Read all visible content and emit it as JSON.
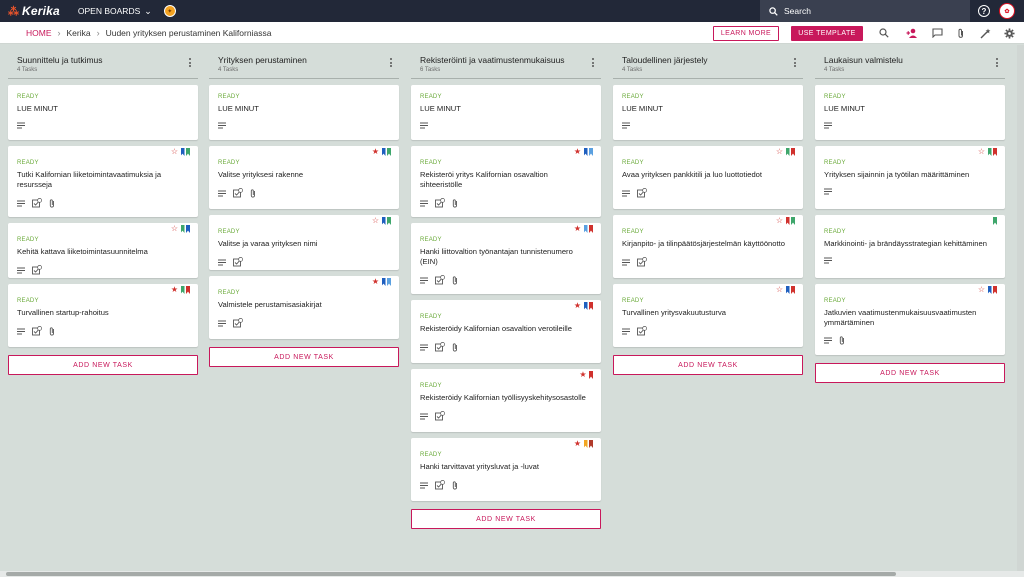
{
  "app": {
    "logo_text": "Kerika",
    "open_boards": "OPEN BOARDS",
    "search_placeholder": "Search"
  },
  "breadcrumb": {
    "home": "HOME",
    "org": "Kerika",
    "board": "Uuden yrityksen perustaminen Kaliforniassa"
  },
  "actions": {
    "learn_more": "LEARN MORE",
    "use_template": "USE TEMPLATE"
  },
  "colors": {
    "accent": "#c8185b",
    "ready": "#6aaa3a",
    "flag_red": "#d0312d",
    "flag_blue": "#1f5fbf",
    "flag_green": "#3ea66b",
    "flag_lightblue": "#5aa0e0",
    "flag_orange": "#f2a622",
    "flag_darkred": "#b13a2a"
  },
  "add_task_label": "ADD NEW TASK",
  "columns": [
    {
      "title": "Suunnittelu ja tutkimus",
      "count": "4 Tasks",
      "cards": [
        {
          "status": "READY",
          "title": "LUE MINUT",
          "star": "",
          "flags": [],
          "icons": [
            "desc"
          ]
        },
        {
          "status": "READY",
          "title": "Tutki Kalifornian liiketoimintavaatimuksia ja resursseja",
          "star": "outline",
          "flags": [
            "#1f5fbf",
            "#3ea66b"
          ],
          "icons": [
            "desc",
            "check",
            "clip"
          ]
        },
        {
          "status": "READY",
          "title": "Kehitä kattava liiketoimintasuunnitelma",
          "star": "outline",
          "flags": [
            "#3ea66b",
            "#1f5fbf"
          ],
          "icons": [
            "desc",
            "check"
          ]
        },
        {
          "status": "READY",
          "title": "Turvallinen startup-rahoitus",
          "star": "filled",
          "flags": [
            "#3ea66b",
            "#d0312d"
          ],
          "icons": [
            "desc",
            "check",
            "clip"
          ]
        }
      ]
    },
    {
      "title": "Yrityksen perustaminen",
      "count": "4 Tasks",
      "cards": [
        {
          "status": "READY",
          "title": "LUE MINUT",
          "star": "",
          "flags": [],
          "icons": [
            "desc"
          ]
        },
        {
          "status": "READY",
          "title": "Valitse yrityksesi rakenne",
          "star": "filled",
          "flags": [
            "#1f5fbf",
            "#3ea66b"
          ],
          "icons": [
            "desc",
            "check",
            "clip"
          ]
        },
        {
          "status": "READY",
          "title": "Valitse ja varaa yrityksen nimi",
          "star": "outline",
          "flags": [
            "#1f5fbf",
            "#3ea66b"
          ],
          "icons": [
            "desc",
            "check"
          ]
        },
        {
          "status": "READY",
          "title": "Valmistele perustamisasiakirjat",
          "star": "filled",
          "flags": [
            "#1f5fbf",
            "#5aa0e0"
          ],
          "icons": [
            "desc",
            "check"
          ]
        }
      ]
    },
    {
      "title": "Rekisteröinti ja vaatimustenmukaisuus",
      "count": "6 Tasks",
      "cards": [
        {
          "status": "READY",
          "title": "LUE MINUT",
          "star": "",
          "flags": [],
          "icons": [
            "desc"
          ]
        },
        {
          "status": "READY",
          "title": "Rekisteröi yritys Kalifornian osavaltion sihteeristölle",
          "star": "filled",
          "flags": [
            "#1f5fbf",
            "#5aa0e0"
          ],
          "icons": [
            "desc",
            "check",
            "clip"
          ]
        },
        {
          "status": "READY",
          "title": "Hanki liittovaltion työnantajan tunnistenumero (EIN)",
          "star": "filled",
          "flags": [
            "#5aa0e0",
            "#d0312d"
          ],
          "icons": [
            "desc",
            "check",
            "clip"
          ]
        },
        {
          "status": "READY",
          "title": "Rekisteröidy Kalifornian osavaltion verotileille",
          "star": "filled",
          "flags": [
            "#1f5fbf",
            "#d0312d"
          ],
          "icons": [
            "desc",
            "check",
            "clip"
          ]
        },
        {
          "status": "READY",
          "title": "Rekisteröidy Kalifornian työllisyyskehitysosastolle",
          "star": "filled",
          "flags": [
            "#d0312d"
          ],
          "icons": [
            "desc",
            "check"
          ]
        },
        {
          "status": "READY",
          "title": "Hanki tarvittavat yritysluvat ja -luvat",
          "star": "filled",
          "flags": [
            "#f2a622",
            "#b13a2a"
          ],
          "icons": [
            "desc",
            "check",
            "clip"
          ]
        }
      ]
    },
    {
      "title": "Taloudellinen järjestely",
      "count": "4 Tasks",
      "cards": [
        {
          "status": "READY",
          "title": "LUE MINUT",
          "star": "",
          "flags": [],
          "icons": [
            "desc"
          ]
        },
        {
          "status": "READY",
          "title": "Avaa yrityksen pankkitili ja luo luottotiedot",
          "star": "outline",
          "flags": [
            "#3ea66b",
            "#d0312d"
          ],
          "icons": [
            "desc",
            "check"
          ]
        },
        {
          "status": "READY",
          "title": "Kirjanpito- ja tilinpäätösjärjestelmän käyttöönotto",
          "star": "outline",
          "flags": [
            "#d0312d",
            "#3ea66b"
          ],
          "icons": [
            "desc",
            "check"
          ]
        },
        {
          "status": "READY",
          "title": "Turvallinen yritysvakuutusturva",
          "star": "outline",
          "flags": [
            "#1f5fbf",
            "#d0312d"
          ],
          "icons": [
            "desc",
            "check"
          ]
        }
      ]
    },
    {
      "title": "Laukaisun valmistelu",
      "count": "4 Tasks",
      "cards": [
        {
          "status": "READY",
          "title": "LUE MINUT",
          "star": "",
          "flags": [],
          "icons": [
            "desc"
          ]
        },
        {
          "status": "READY",
          "title": "Yrityksen sijainnin ja työtilan määrittäminen",
          "star": "outline",
          "flags": [
            "#3ea66b",
            "#d0312d"
          ],
          "icons": [
            "desc"
          ]
        },
        {
          "status": "READY",
          "title": "Markkinointi- ja brändäysstrategian kehittäminen",
          "star": "",
          "flags": [
            "#3ea66b"
          ],
          "icons": [
            "desc"
          ]
        },
        {
          "status": "READY",
          "title": "Jatkuvien vaatimustenmukaisuusvaatimusten ymmärtäminen",
          "star": "outline",
          "flags": [
            "#1f5fbf",
            "#d0312d"
          ],
          "icons": [
            "desc",
            "clip"
          ]
        }
      ]
    }
  ]
}
